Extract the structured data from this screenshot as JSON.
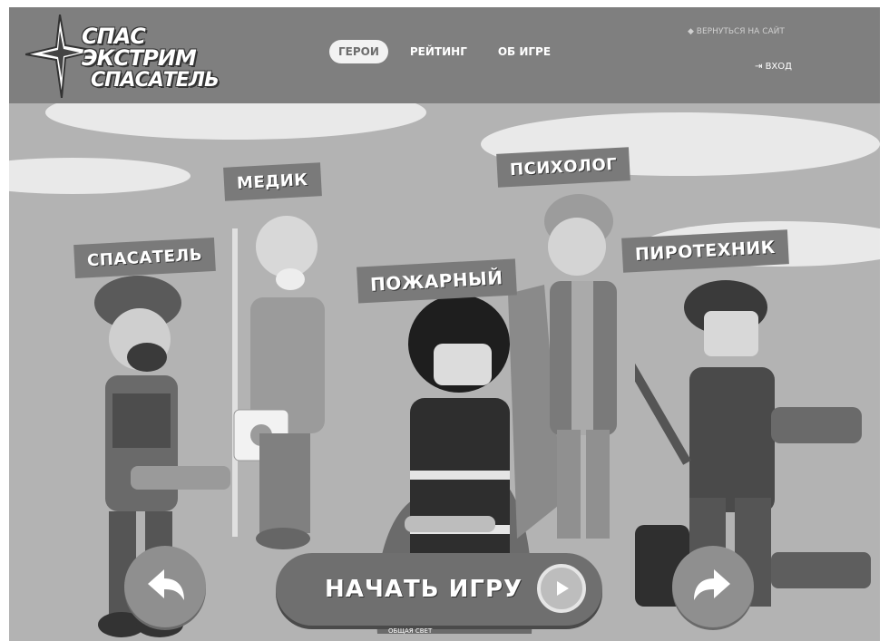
{
  "logo": {
    "line1": "СПАС",
    "line2": "ЭКСТРИМ",
    "line3": "СПАСАТЕЛЬ"
  },
  "nav": {
    "items": [
      "ГЕРОИ",
      "РЕЙТИНГ",
      "ОБ ИГРЕ"
    ],
    "active_index": 0
  },
  "header_links": {
    "back_to_site": "ВЕРНУТЬСЯ НА САЙТ",
    "login": "ВХОД"
  },
  "characters": [
    "СПАСАТЕЛЬ",
    "МЕДИК",
    "ПОЖАРНЫЙ",
    "ПСИХОЛОГ",
    "ПИРОТЕХНИК"
  ],
  "start_button": {
    "label": "НАЧАТЬ ИГРУ"
  },
  "arrows": {
    "prev_icon": "arrow-left-icon",
    "next_icon": "arrow-right-icon"
  },
  "caption_under_button": "ОБЩАЯ СВЕТ"
}
